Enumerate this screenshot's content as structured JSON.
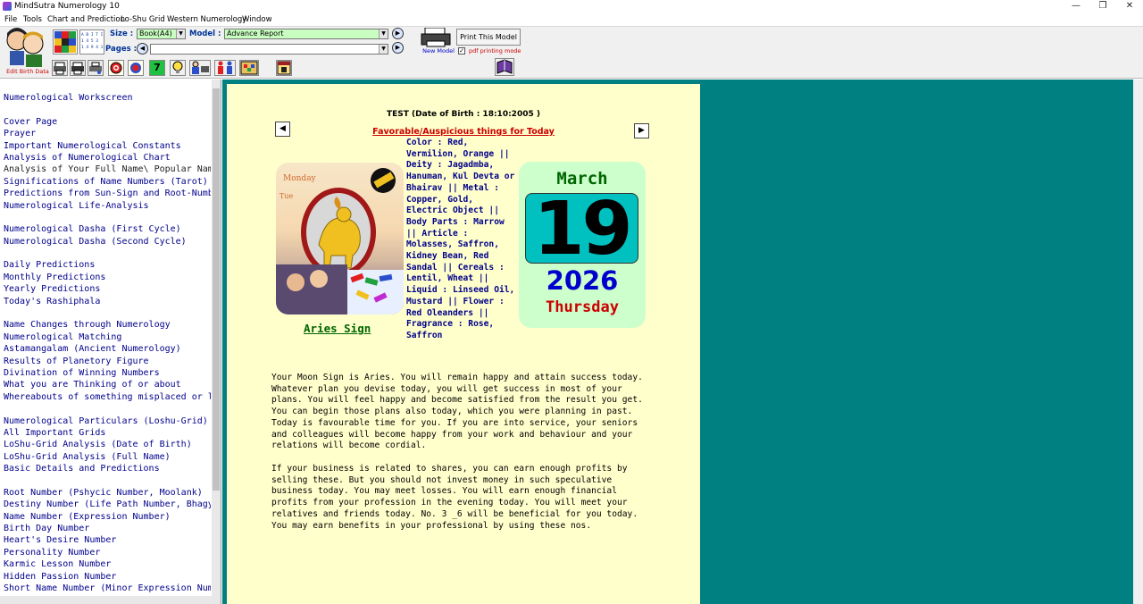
{
  "window": {
    "title": "MindSutra Numerology 10",
    "minimize": "—",
    "restore": "❐",
    "close": "✕"
  },
  "menu": [
    "File",
    "Tools",
    "Chart and Prediction",
    "Lo-Shu Grid",
    "Western Numerology",
    "Window"
  ],
  "toolbar": {
    "edit_birth_data": "Edit Birth Data",
    "size_label": "Size :",
    "size_value": "Book(A4)",
    "model_label": "Model :",
    "model_value": "Advance Report",
    "pages_label": "Pages :",
    "pages_value": "",
    "new_model": "New Model",
    "print_model": "Print This Model",
    "pdf_mode": "pdf printing mode",
    "grid_icon_text": "A B I T I\n1 4 5 3\n1 4 9 4 1"
  },
  "nav": [
    {
      "label": "Numerological Workscreen"
    },
    {
      "gap": true
    },
    {
      "label": "Cover Page"
    },
    {
      "label": "Prayer"
    },
    {
      "label": "Important Numerological Constants"
    },
    {
      "label": "Analysis of Numerological Chart"
    },
    {
      "label": "Analysis of Your Full Name\\ Popular Name",
      "dark": true
    },
    {
      "label": "Significations of Name Numbers (Tarot)"
    },
    {
      "label": "Predictions from Sun-Sign and Root-Number"
    },
    {
      "label": "Numerological Life-Analysis"
    },
    {
      "gap": true
    },
    {
      "label": "Numerological Dasha (First Cycle)"
    },
    {
      "label": "Numerological Dasha (Second Cycle)"
    },
    {
      "gap": true
    },
    {
      "label": "Daily Predictions"
    },
    {
      "label": "Monthly Predictions"
    },
    {
      "label": "Yearly Predictions"
    },
    {
      "label": "Today's Rashiphala"
    },
    {
      "gap": true
    },
    {
      "label": "Name Changes through Numerology"
    },
    {
      "label": "Numerological Matching"
    },
    {
      "label": "Astamangalam (Ancient Numerology)"
    },
    {
      "label": "Results of Planetory Figure"
    },
    {
      "label": "Divination of Winning Numbers"
    },
    {
      "label": "What you are Thinking of or about"
    },
    {
      "label": "Whereabouts of something misplaced or lost"
    },
    {
      "gap": true
    },
    {
      "label": "Numerological Particulars (Loshu-Grid)"
    },
    {
      "label": "All Important Grids"
    },
    {
      "label": "LoShu-Grid Analysis (Date of Birth)"
    },
    {
      "label": "LoShu-Grid Analysis (Full Name)"
    },
    {
      "label": "Basic Details and Predictions"
    },
    {
      "gap": true
    },
    {
      "label": "Root Number (Pshycic Number, Moolank)"
    },
    {
      "label": "Destiny Number (Life Path Number, Bhagyank)"
    },
    {
      "label": "Name Number (Expression Number)"
    },
    {
      "label": "Birth Day Number"
    },
    {
      "label": "Heart's Desire Number"
    },
    {
      "label": "Personality Number"
    },
    {
      "label": "Karmic Lesson Number"
    },
    {
      "label": "Hidden Passion Number"
    },
    {
      "label": "Short Name Number (Minor Expression Number)"
    }
  ],
  "report": {
    "header": "TEST  (Date of Birth : 18:10:2005 )",
    "section_title": "Favorable/Auspicious things for Today",
    "prev": "◀",
    "next": "▶",
    "sign_name": "Aries Sign",
    "details": "Color : Red, Vermilion, Orange || Deity : Jagadmba, Hanuman, Kul Devta or Bhairav || Metal : Copper, Gold, Electric Object || Body Parts : Marrow || Article : Molasses, Saffron, Kidney Bean, Red Sandal || Cereals : Lentil, Wheat || Liquid : Linseed Oil, Mustard || Flower : Red Oleanders || Fragrance : Rose, Saffron",
    "calendar": {
      "month": "March",
      "day": "19",
      "year": "2026",
      "weekday": "Thursday"
    },
    "paragraph1": "Your Moon Sign is Aries. You will remain happy and attain success today. Whatever plan you devise today, you will get success in most of your plans. You will feel happy and become satisfied from the result you get. You can begin those plans also today, which you were planning in past. Today is favourable time for you. If you are into service, your seniors and colleagues will become happy from your work and behaviour and your relations will become cordial.",
    "paragraph2": "If your business is related to shares, you can earn enough profits by selling these. But you should not invest money in such speculative business today. You may meet losses. You will earn enough financial profits from your profession in the evening today. You will meet your relatives and friends today. No. 3 _6 will be beneficial for you today. You may earn benefits in your professional by using these nos."
  }
}
